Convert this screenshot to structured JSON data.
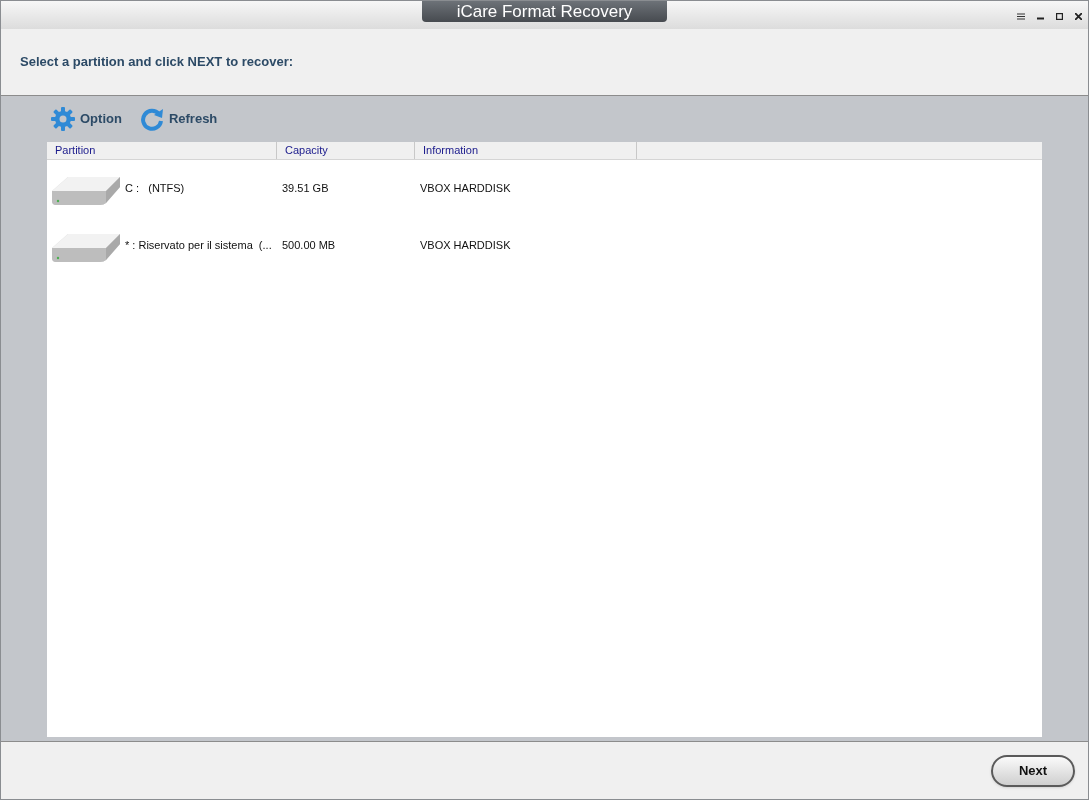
{
  "window": {
    "title": "iCare Format Recovery"
  },
  "instruction": "Select a partition and click NEXT to recover:",
  "toolbar": [
    {
      "kind": "option",
      "label": "Option"
    },
    {
      "kind": "refresh",
      "label": "Refresh"
    }
  ],
  "table": {
    "columns": [
      "Partition",
      "Capacity",
      "Information"
    ],
    "rows": [
      {
        "partition": "C :   (NTFS)",
        "capacity": "39.51 GB",
        "information": "VBOX HARDDISK"
      },
      {
        "partition": "* : Riservato per il sistema  (...",
        "capacity": "500.00 MB",
        "information": "VBOX HARDDISK"
      }
    ]
  },
  "buttons": {
    "next": "Next"
  }
}
